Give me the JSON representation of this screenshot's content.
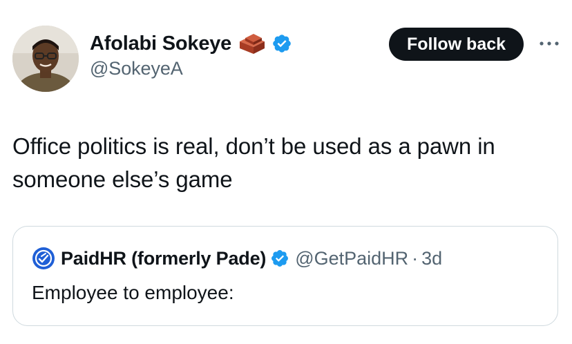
{
  "tweet": {
    "author": {
      "display_name": "Afolabi Sokeye",
      "handle": "@SokeyeA",
      "emoji": "brick-icon",
      "verified": true,
      "avatar": "avatar-photo"
    },
    "follow_button_label": "Follow back",
    "more_icon": "more-options-icon",
    "text": "Office politics is real, don’t be used as a pawn in someone else’s game"
  },
  "quote": {
    "display_name": "PaidHR (formerly Pade)",
    "handle": "@GetPaidHR",
    "separator": "·",
    "time": "3d",
    "text": "Employee to employee:",
    "verified": true
  },
  "colors": {
    "text_primary": "#0f1419",
    "text_secondary": "#536471",
    "verified_blue": "#1d9bf0",
    "button_bg": "#0f1419",
    "border": "#cfd9de",
    "brick": "#b4462b"
  }
}
